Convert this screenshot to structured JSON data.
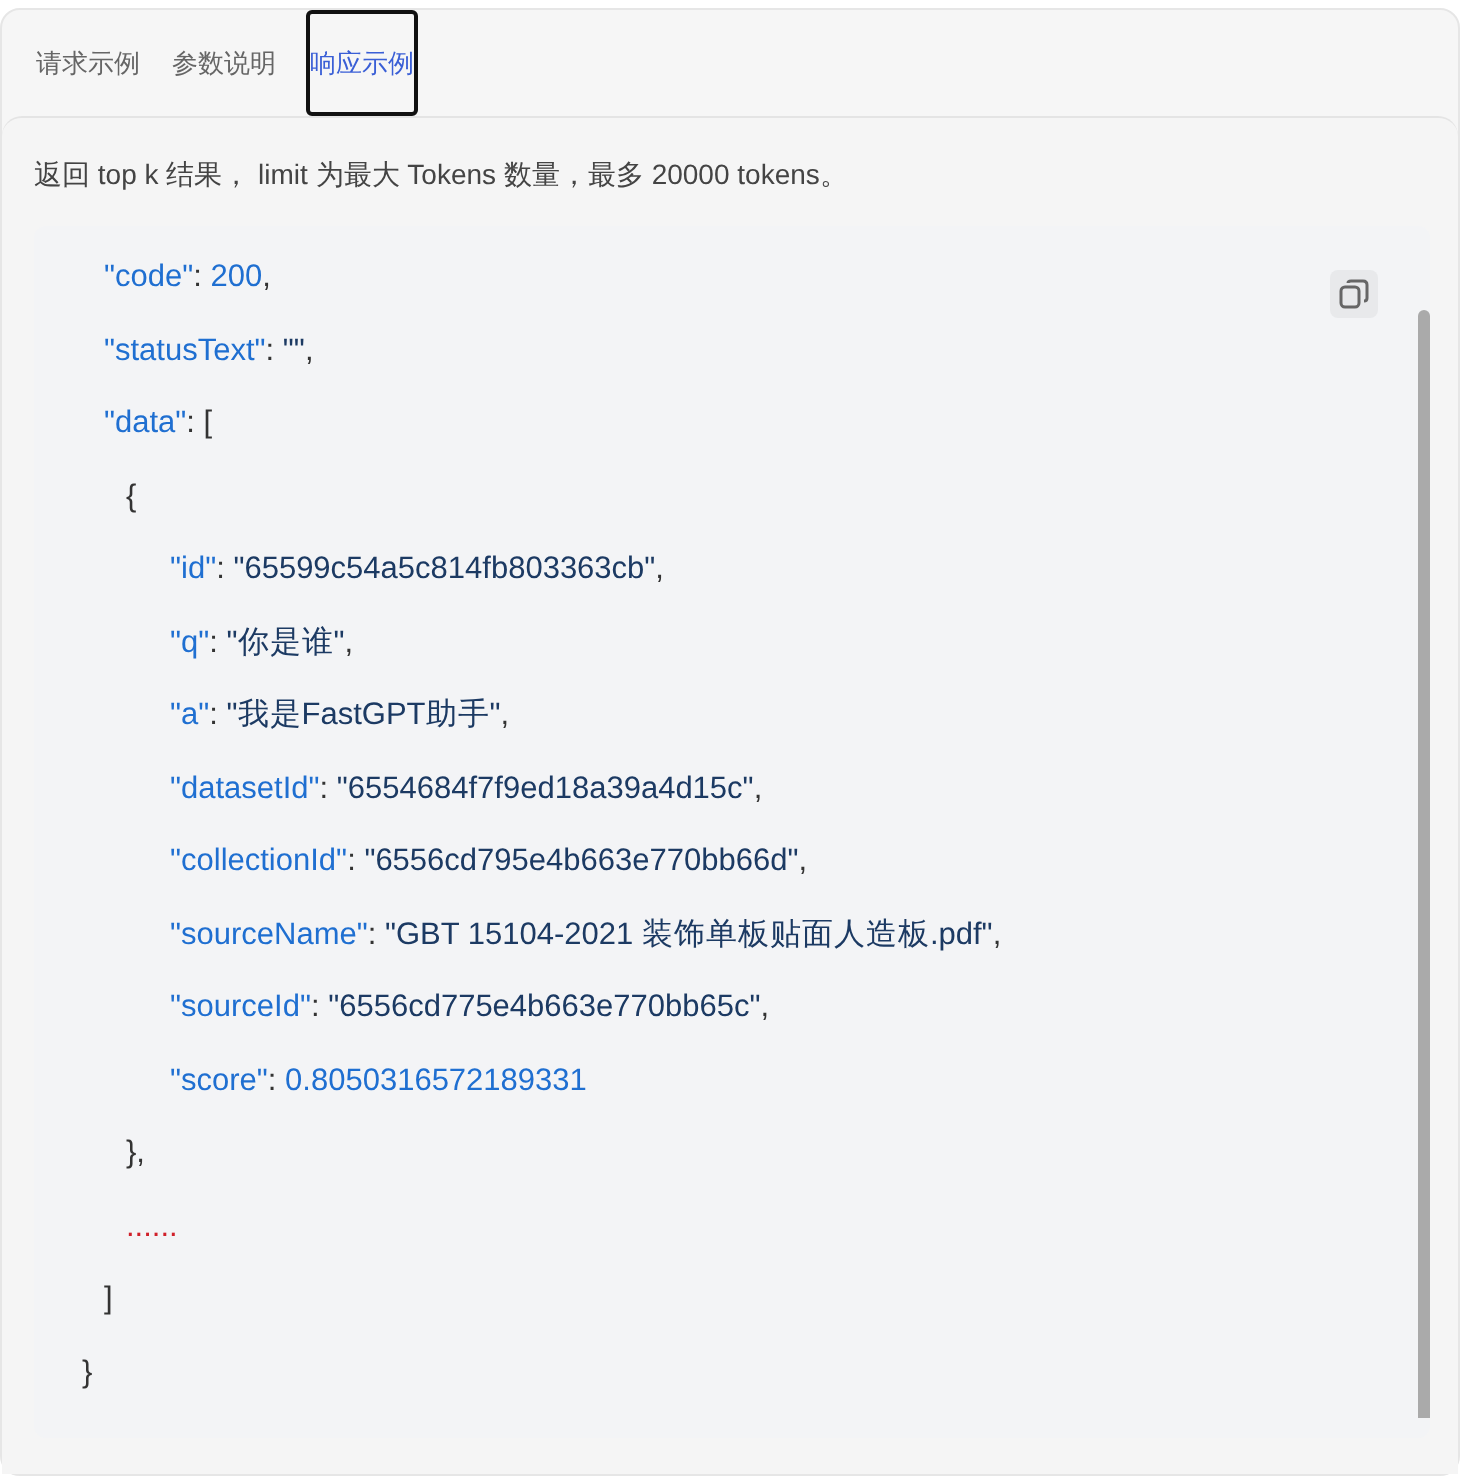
{
  "tabs": [
    {
      "label": "请求示例",
      "selected": false
    },
    {
      "label": "参数说明",
      "selected": false
    },
    {
      "label": "响应示例",
      "selected": true
    }
  ],
  "description": "返回 top k 结果， limit 为最大 Tokens 数量，最多 20000 tokens。",
  "code": {
    "lines": [
      {
        "children": [
          {
            "tokens": [
              {
                "kind": "key",
                "text": "\"code\""
              },
              {
                "kind": "punct",
                "text": ": "
              },
              {
                "kind": "number",
                "text": "200"
              },
              {
                "kind": "punct",
                "text": ","
              }
            ]
          },
          {
            "tokens": [
              {
                "kind": "key",
                "text": "\"statusText\""
              },
              {
                "kind": "punct",
                "text": ": "
              },
              {
                "kind": "string",
                "text": "\"\""
              },
              {
                "kind": "punct",
                "text": ","
              }
            ]
          },
          {
            "tokens": [
              {
                "kind": "key",
                "text": "\"data\""
              },
              {
                "kind": "punct",
                "text": ": ["
              }
            ],
            "children": [
              {
                "tokens": [
                  {
                    "kind": "punct",
                    "text": "{"
                  }
                ],
                "children": [
                  {
                    "tokens": [
                      {
                        "kind": "key",
                        "text": "\"id\""
                      },
                      {
                        "kind": "punct",
                        "text": ": "
                      },
                      {
                        "kind": "string",
                        "text": "\"65599c54a5c814fb803363cb\""
                      },
                      {
                        "kind": "punct",
                        "text": ","
                      }
                    ]
                  },
                  {
                    "tokens": [
                      {
                        "kind": "key",
                        "text": "\"q\""
                      },
                      {
                        "kind": "punct",
                        "text": ": "
                      },
                      {
                        "kind": "string",
                        "text": "\"你是谁\""
                      },
                      {
                        "kind": "punct",
                        "text": ","
                      }
                    ]
                  },
                  {
                    "tokens": [
                      {
                        "kind": "key",
                        "text": "\"a\""
                      },
                      {
                        "kind": "punct",
                        "text": ": "
                      },
                      {
                        "kind": "string",
                        "text": "\"我是FastGPT助手\""
                      },
                      {
                        "kind": "punct",
                        "text": ","
                      }
                    ]
                  },
                  {
                    "tokens": [
                      {
                        "kind": "key",
                        "text": "\"datasetId\""
                      },
                      {
                        "kind": "punct",
                        "text": ": "
                      },
                      {
                        "kind": "string",
                        "text": "\"6554684f7f9ed18a39a4d15c\""
                      },
                      {
                        "kind": "punct",
                        "text": ","
                      }
                    ]
                  },
                  {
                    "tokens": [
                      {
                        "kind": "key",
                        "text": "\"collectionId\""
                      },
                      {
                        "kind": "punct",
                        "text": ": "
                      },
                      {
                        "kind": "string",
                        "text": "\"6556cd795e4b663e770bb66d\""
                      },
                      {
                        "kind": "punct",
                        "text": ","
                      }
                    ]
                  },
                  {
                    "tokens": [
                      {
                        "kind": "key",
                        "text": "\"sourceName\""
                      },
                      {
                        "kind": "punct",
                        "text": ": "
                      },
                      {
                        "kind": "string",
                        "text": "\"GBT 15104-2021 装饰单板贴面人造板.pdf\""
                      },
                      {
                        "kind": "punct",
                        "text": ","
                      }
                    ]
                  },
                  {
                    "tokens": [
                      {
                        "kind": "key",
                        "text": "\"sourceId\""
                      },
                      {
                        "kind": "punct",
                        "text": ": "
                      },
                      {
                        "kind": "string",
                        "text": "\"6556cd775e4b663e770bb65c\""
                      },
                      {
                        "kind": "punct",
                        "text": ","
                      }
                    ]
                  },
                  {
                    "tokens": [
                      {
                        "kind": "key",
                        "text": "\"score\""
                      },
                      {
                        "kind": "punct",
                        "text": ": "
                      },
                      {
                        "kind": "number",
                        "text": "0.8050316572189331"
                      }
                    ]
                  }
                ]
              },
              {
                "tokens": [
                  {
                    "kind": "punct",
                    "text": "},"
                  }
                ]
              },
              {
                "tokens": [
                  {
                    "kind": "ellipsis",
                    "text": "......"
                  }
                ]
              }
            ]
          },
          {
            "tokens": [
              {
                "kind": "punct",
                "text": "]"
              }
            ]
          }
        ]
      },
      {
        "tokens": [
          {
            "kind": "punct",
            "text": "}"
          }
        ]
      }
    ]
  }
}
